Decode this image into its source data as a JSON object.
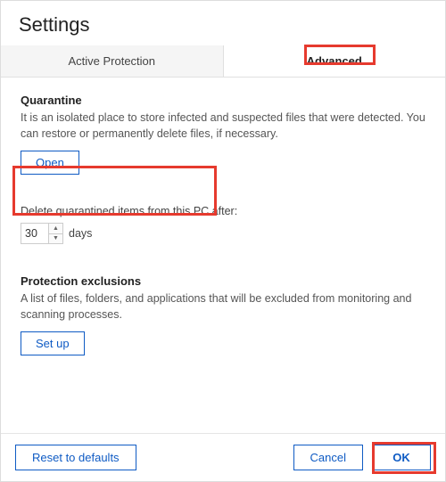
{
  "header": {
    "title": "Settings"
  },
  "tabs": {
    "active_protection": "Active Protection",
    "advanced": "Advanced"
  },
  "quarantine": {
    "title": "Quarantine",
    "desc": "It is an isolated place to store infected and suspected files that were detected. You can restore or permanently delete files, if necessary.",
    "open_btn": "Open"
  },
  "delete_after": {
    "label": "Delete quarantined items from this PC after:",
    "value": "30",
    "unit": "days"
  },
  "exclusions": {
    "title": "Protection exclusions",
    "desc": "A list of files, folders, and applications that will be excluded from monitoring and scanning processes.",
    "setup_btn": "Set up"
  },
  "footer": {
    "reset": "Reset to defaults",
    "cancel": "Cancel",
    "ok": "OK"
  }
}
